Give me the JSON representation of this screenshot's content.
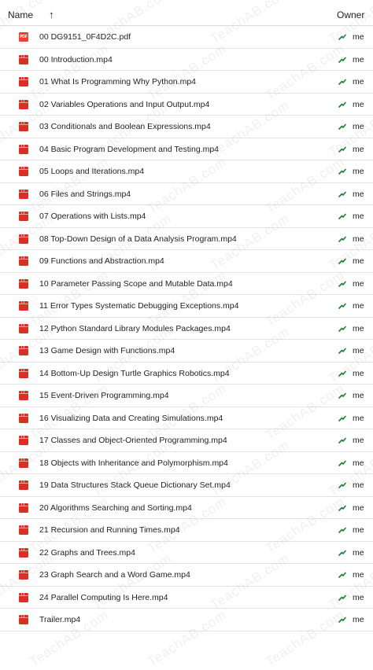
{
  "header": {
    "name_label": "Name",
    "sort_icon": "arrow-up",
    "owner_label": "Owner"
  },
  "colors": {
    "video_icon": "#d93025",
    "pdf_icon": "#ea4335",
    "shared_icon": "#188038"
  },
  "files": [
    {
      "name": "00 DG9151_0F4D2C.pdf",
      "type": "pdf",
      "badge": "PDF",
      "owner": "me"
    },
    {
      "name": "00 Introduction.mp4",
      "type": "video",
      "owner": "me"
    },
    {
      "name": "01 What Is Programming Why Python.mp4",
      "type": "video",
      "owner": "me"
    },
    {
      "name": "02 Variables Operations and Input Output.mp4",
      "type": "video",
      "owner": "me"
    },
    {
      "name": "03 Conditionals and Boolean Expressions.mp4",
      "type": "video",
      "owner": "me"
    },
    {
      "name": "04 Basic Program Development and Testing.mp4",
      "type": "video",
      "owner": "me"
    },
    {
      "name": "05 Loops and Iterations.mp4",
      "type": "video",
      "owner": "me"
    },
    {
      "name": "06 Files and Strings.mp4",
      "type": "video",
      "owner": "me"
    },
    {
      "name": "07 Operations with Lists.mp4",
      "type": "video",
      "owner": "me"
    },
    {
      "name": "08 Top-Down Design of a Data Analysis Program.mp4",
      "type": "video",
      "owner": "me"
    },
    {
      "name": "09 Functions and Abstraction.mp4",
      "type": "video",
      "owner": "me"
    },
    {
      "name": "10 Parameter Passing Scope and Mutable Data.mp4",
      "type": "video",
      "owner": "me"
    },
    {
      "name": "11 Error Types Systematic Debugging Exceptions.mp4",
      "type": "video",
      "owner": "me"
    },
    {
      "name": "12 Python Standard Library Modules Packages.mp4",
      "type": "video",
      "owner": "me"
    },
    {
      "name": "13 Game Design with Functions.mp4",
      "type": "video",
      "owner": "me"
    },
    {
      "name": "14 Bottom-Up Design Turtle Graphics Robotics.mp4",
      "type": "video",
      "owner": "me"
    },
    {
      "name": "15 Event-Driven Programming.mp4",
      "type": "video",
      "owner": "me"
    },
    {
      "name": "16 Visualizing Data and Creating Simulations.mp4",
      "type": "video",
      "owner": "me"
    },
    {
      "name": "17 Classes and Object-Oriented Programming.mp4",
      "type": "video",
      "owner": "me"
    },
    {
      "name": "18 Objects with Inheritance and Polymorphism.mp4",
      "type": "video",
      "owner": "me"
    },
    {
      "name": "19 Data Structures Stack Queue Dictionary Set.mp4",
      "type": "video",
      "owner": "me"
    },
    {
      "name": "20 Algorithms Searching and Sorting.mp4",
      "type": "video",
      "owner": "me"
    },
    {
      "name": "21 Recursion and Running Times.mp4",
      "type": "video",
      "owner": "me"
    },
    {
      "name": "22 Graphs and Trees.mp4",
      "type": "video",
      "owner": "me"
    },
    {
      "name": "23 Graph Search and a Word Game.mp4",
      "type": "video",
      "owner": "me"
    },
    {
      "name": "24 Parallel Computing Is Here.mp4",
      "type": "video",
      "owner": "me"
    },
    {
      "name": "Trailer.mp4",
      "type": "video",
      "owner": "me"
    }
  ],
  "watermark": {
    "text": "TeachAB.com"
  }
}
